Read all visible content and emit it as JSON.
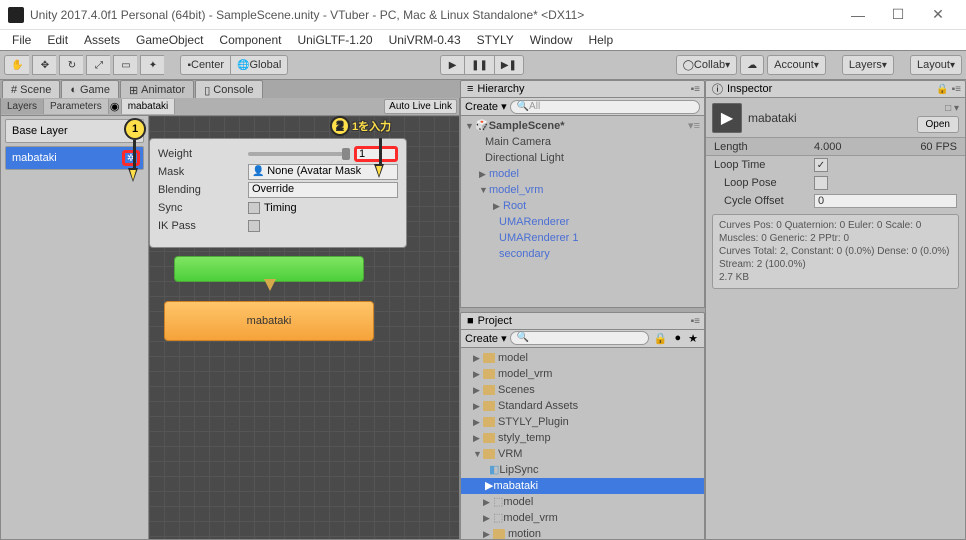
{
  "window": {
    "title": "Unity 2017.4.0f1 Personal (64bit) - SampleScene.unity - VTuber - PC, Mac & Linux Standalone* <DX11>"
  },
  "menu": [
    "File",
    "Edit",
    "Assets",
    "GameObject",
    "Component",
    "UniGLTF-1.20",
    "UniVRM-0.43",
    "STYLY",
    "Window",
    "Help"
  ],
  "toolbar": {
    "center": "Center",
    "global": "Global",
    "collab": "Collab",
    "account": "Account",
    "layers": "Layers",
    "layout": "Layout"
  },
  "tabs": {
    "scene": "Scene",
    "game": "Game",
    "animator": "Animator",
    "console": "Console"
  },
  "animator": {
    "subtabs": {
      "layers": "Layers",
      "parameters": "Parameters"
    },
    "breadcrumb": "mabataki",
    "autolive": "Auto Live Link",
    "layers": [
      "Base Layer",
      "mabataki"
    ],
    "popup": {
      "weight_label": "Weight",
      "weight_value": "1",
      "mask_label": "Mask",
      "mask_value": "None (Avatar Mask",
      "blending_label": "Blending",
      "blending_value": "Override",
      "sync_label": "Sync",
      "timing_label": "Timing",
      "ikpass_label": "IK Pass"
    },
    "node_orange": "mabataki"
  },
  "hierarchy": {
    "title": "Hierarchy",
    "create": "Create",
    "search_ph": "All",
    "items": [
      "SampleScene*",
      "Main Camera",
      "Directional Light",
      "model",
      "model_vrm",
      "Root",
      "UMARenderer",
      "UMARenderer 1",
      "secondary"
    ]
  },
  "project": {
    "title": "Project",
    "create": "Create",
    "items": [
      "model",
      "model_vrm",
      "Scenes",
      "Standard Assets",
      "STYLY_Plugin",
      "styly_temp",
      "VRM",
      "LipSync",
      "mabataki",
      "model",
      "model_vrm",
      "motion"
    ]
  },
  "inspector": {
    "title": "Inspector",
    "name": "mabataki",
    "open": "Open",
    "length_label": "Length",
    "length_value": "4.000",
    "fps": "60 FPS",
    "loop_time": "Loop Time",
    "loop_pose": "Loop Pose",
    "cycle_offset": "Cycle Offset",
    "cycle_value": "0",
    "info": "Curves Pos: 0 Quaternion: 0 Euler: 0 Scale: 0\nMuscles: 0 Generic: 2 PPtr: 0\nCurves Total: 2, Constant: 0 (0.0%) Dense: 0 (0.0%) Stream: 2 (100.0%)\n2.7 KB"
  },
  "annotations": {
    "b1": "1",
    "b2": "2",
    "b2_text": "1を入力"
  }
}
